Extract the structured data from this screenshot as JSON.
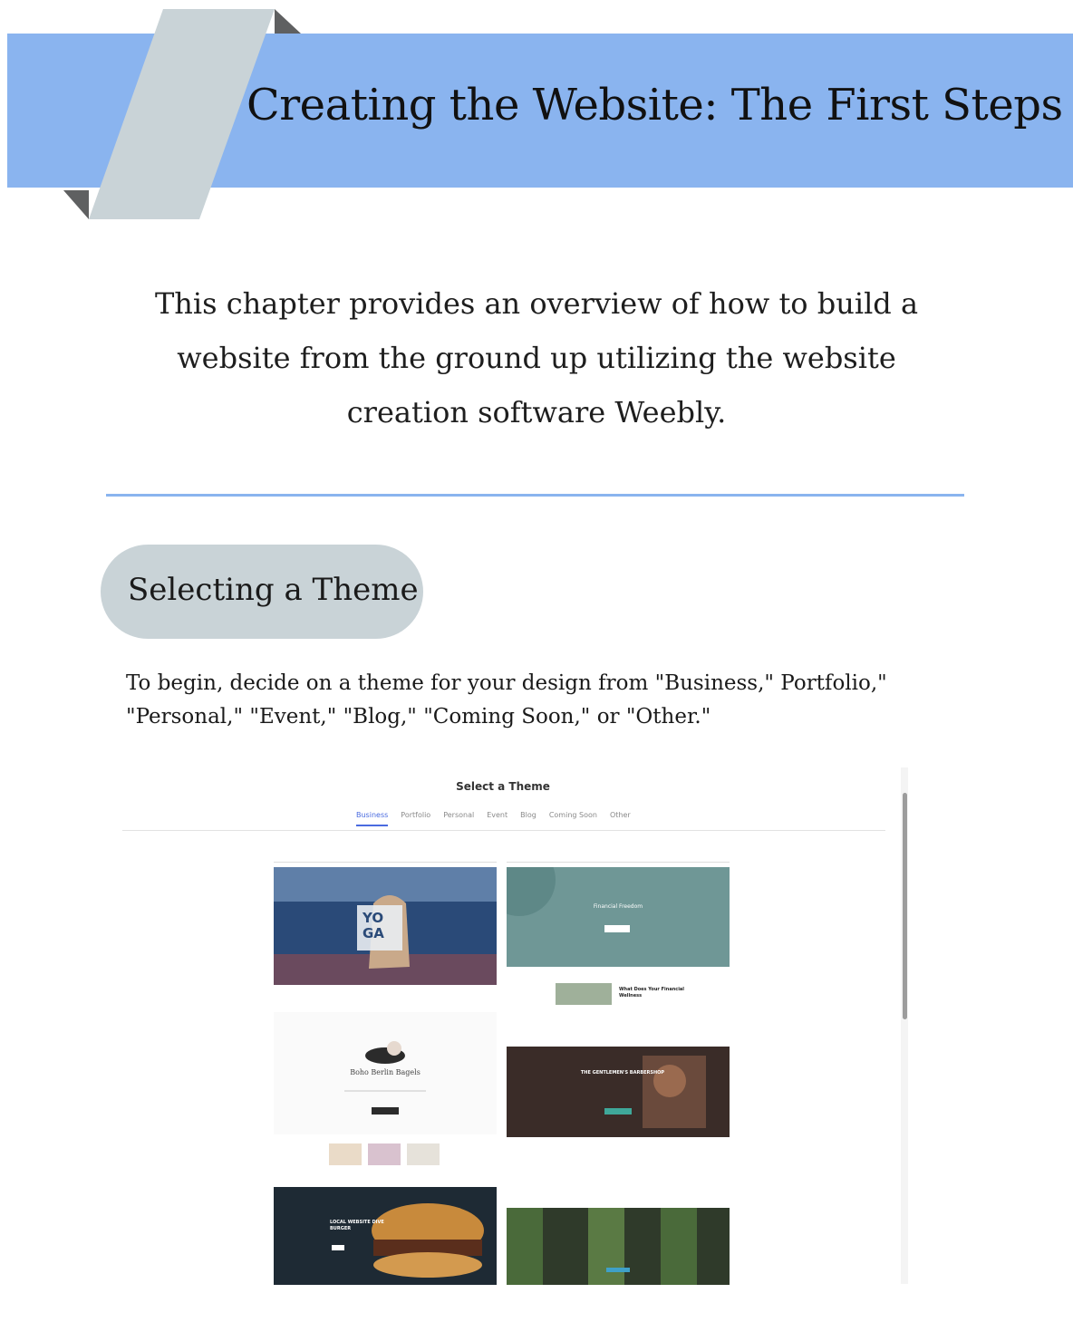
{
  "chapter": {
    "title": "Creating the Website: The First Steps",
    "intro": "This chapter provides an overview of how to build a website from the ground up utilizing the website creation software Weebly."
  },
  "colors": {
    "banner": "#8ab4ef",
    "ribbon": "#c9d3d7",
    "ribbon_fold": "#5f6061",
    "pill": "#c9d3d7",
    "divider": "#8ab4ef"
  },
  "section": {
    "heading": "Selecting a Theme",
    "body": "To begin, decide on a theme for your design from \"Business,\" Portfolio,\" \"Personal,\" \"Event,\" \"Blog,\" \"Coming Soon,\" or \"Other.\""
  },
  "screenshot": {
    "title": "Select a Theme",
    "tabs": [
      "Business",
      "Portfolio",
      "Personal",
      "Event",
      "Blog",
      "Coming Soon",
      "Other"
    ],
    "active_tab": "Business",
    "thumbnails": [
      {
        "overlay": "YO GA"
      },
      {
        "overlay": "Financial Freedom"
      },
      {
        "overlay": "What Does Your Financial Wellness"
      },
      {
        "overlay": "Boho Berlin Bagels"
      },
      {
        "overlay": "THE GENTLEMEN'S BARBERSHOP"
      },
      {
        "overlay": "LOCAL WEBSITE DIVE BURGER"
      }
    ]
  }
}
